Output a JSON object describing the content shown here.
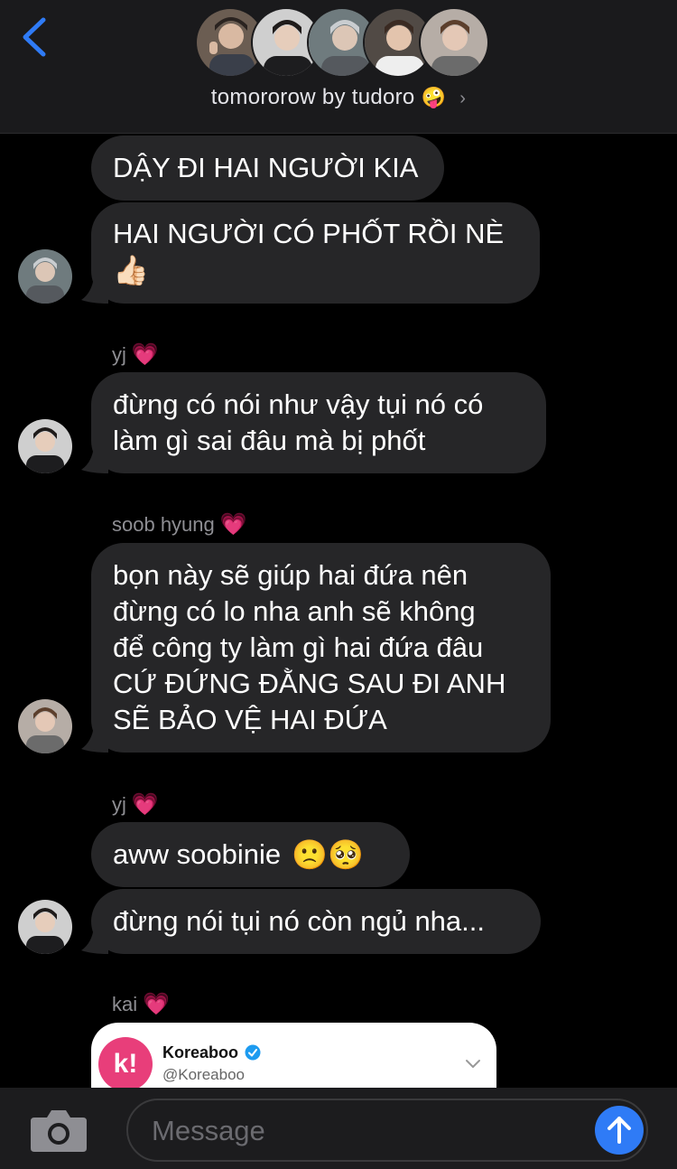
{
  "header": {
    "title": "tomororow by tudoro",
    "title_emoji": "🤪",
    "back_icon": "chevron-left-icon",
    "accent": "#2f7bf6"
  },
  "messages": [
    {
      "lines": [
        "DẬY ĐI HAI NGƯỜI KIA"
      ]
    },
    {
      "lines": [
        "HAI NGƯỜI CÓ PHỐT RỒI NÈ",
        "👍🏻"
      ]
    },
    {
      "sender": "yj",
      "lines": [
        "đừng có nói như vậy tụi nó có",
        "làm gì sai đâu mà bị phốt"
      ]
    },
    {
      "sender": "soob hyung",
      "lines": [
        "bọn này sẽ giúp hai đứa nên",
        "đừng có lo nha anh sẽ không",
        "để công ty làm gì hai đứa đâu",
        "CỨ ĐỨNG ĐẰNG SAU ĐI ANH",
        "SẼ BẢO VỆ HAI ĐỨA"
      ]
    },
    {
      "sender": "yj",
      "lines": [
        "aww soobinie",
        "🙁🥺"
      ]
    },
    {
      "lines": [
        "đừng nói tụi nó còn ngủ nha..."
      ]
    }
  ],
  "heart_emoji": "💗",
  "kai_sender": "kai",
  "shared_card": {
    "name": "Koreaboo",
    "handle": "@Koreaboo",
    "logo_text": "k!",
    "verified_icon": "verified-badge-icon"
  },
  "composer": {
    "placeholder": "Message",
    "camera_icon": "camera-icon",
    "send_icon": "arrow-up-icon"
  }
}
